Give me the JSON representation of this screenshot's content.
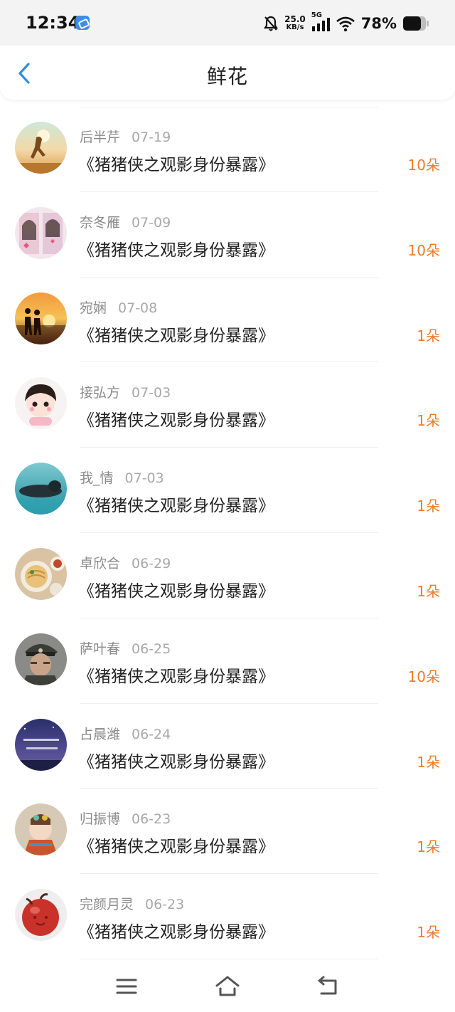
{
  "status_bar": {
    "time": "12:34",
    "speed_value": "25.0",
    "speed_unit": "KB/s",
    "network": "5G",
    "battery": "78%"
  },
  "header": {
    "title": "鲜花"
  },
  "colors": {
    "accent": "#ef7a2a",
    "back": "#2f8fdc"
  },
  "items": [
    {
      "user": "后半芹",
      "date": "07-19",
      "book": "《猪猪侠之观影身份暴露》",
      "count": "10朵",
      "avatar": "silhouette-runner"
    },
    {
      "user": "奈冬雁",
      "date": "07-09",
      "book": "《猪猪侠之观影身份暴露》",
      "count": "10朵",
      "avatar": "selfie-pink"
    },
    {
      "user": "宛娴",
      "date": "07-08",
      "book": "《猪猪侠之观影身份暴露》",
      "count": "1朵",
      "avatar": "couple-sunset"
    },
    {
      "user": "接弘方",
      "date": "07-03",
      "book": "《猪猪侠之观影身份暴露》",
      "count": "1朵",
      "avatar": "cartoon-girl"
    },
    {
      "user": "我_情",
      "date": "07-03",
      "book": "《猪猪侠之观影身份暴露》",
      "count": "1朵",
      "avatar": "buddha-water"
    },
    {
      "user": "卓欣合",
      "date": "06-29",
      "book": "《猪猪侠之观影身份暴露》",
      "count": "1朵",
      "avatar": "noodle-food"
    },
    {
      "user": "萨叶春",
      "date": "06-25",
      "book": "《猪猪侠之观影身份暴露》",
      "count": "10朵",
      "avatar": "officer-portrait"
    },
    {
      "user": "占晨潍",
      "date": "06-24",
      "book": "《猪猪侠之观影身份暴露》",
      "count": "1朵",
      "avatar": "night-text"
    },
    {
      "user": "归振博",
      "date": "06-23",
      "book": "《猪猪侠之观影身份暴露》",
      "count": "1朵",
      "avatar": "cartoon-colorful"
    },
    {
      "user": "完颜月灵",
      "date": "06-23",
      "book": "《猪猪侠之观影身份暴露》",
      "count": "1朵",
      "avatar": "red-apple"
    }
  ],
  "nav": {
    "menu_icon": "menu-icon",
    "home_icon": "home-icon",
    "back_icon": "back-nav-icon"
  }
}
